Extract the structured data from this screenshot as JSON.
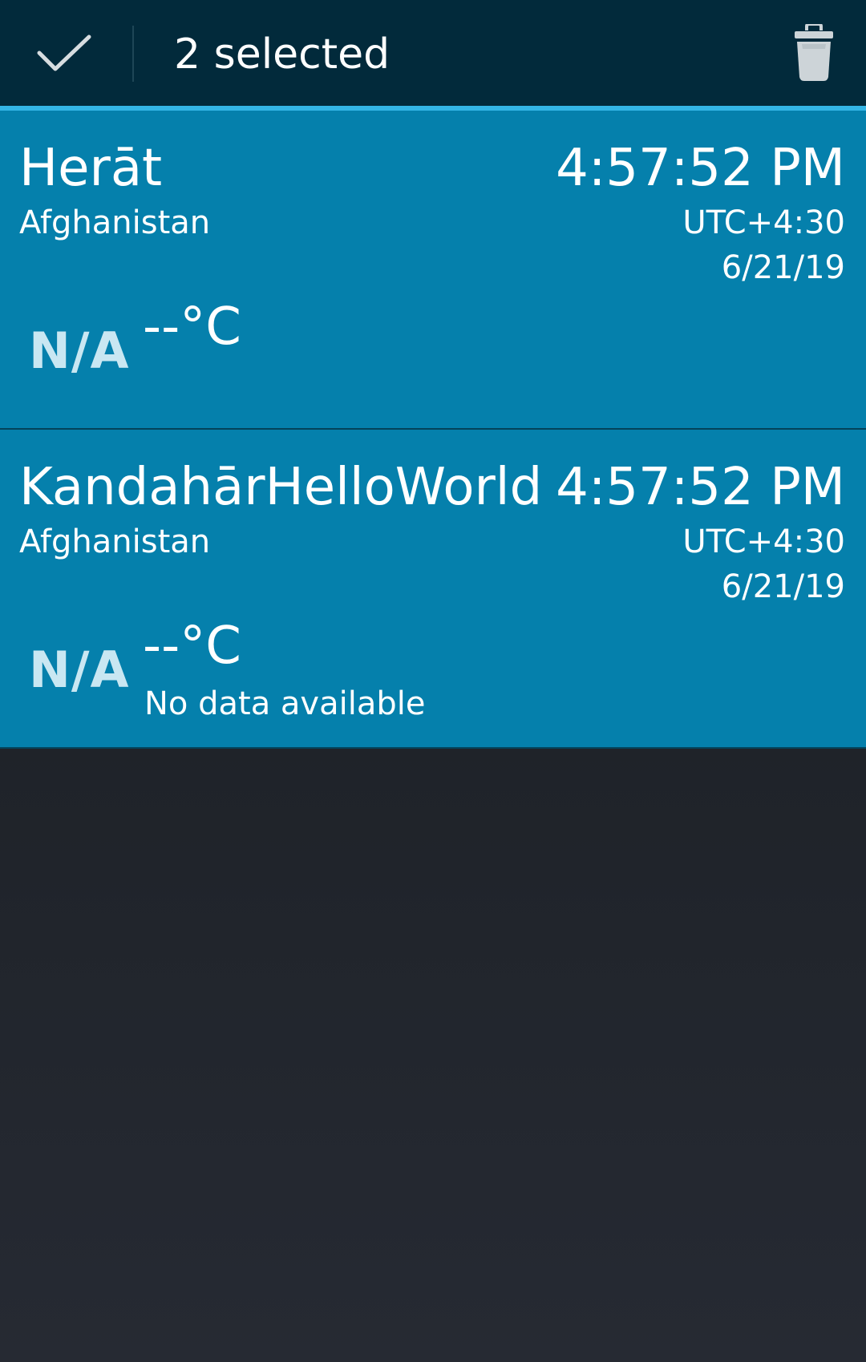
{
  "action_bar": {
    "done_icon": "checkmark-icon",
    "selection_text": "2 selected",
    "delete_icon": "trash-icon",
    "background_color": "#022a3b",
    "accent_color": "#33b5e5"
  },
  "cities": [
    {
      "name": "Herāt",
      "country": "Afghanistan",
      "time": "4:57:52 PM",
      "utc_offset": "UTC+4:30",
      "date": "6/21/19",
      "weather_icon_text": "N/A",
      "temperature": "--°C",
      "status": ""
    },
    {
      "name": "KandahārHelloWorld",
      "country": "Afghanistan",
      "time": "4:57:52 PM",
      "utc_offset": "UTC+4:30",
      "date": "6/21/19",
      "weather_icon_text": "N/A",
      "temperature": "--°C",
      "status": "No data available"
    }
  ],
  "colors": {
    "card_selected": "#0580ac",
    "page_background": "#1e2228"
  }
}
